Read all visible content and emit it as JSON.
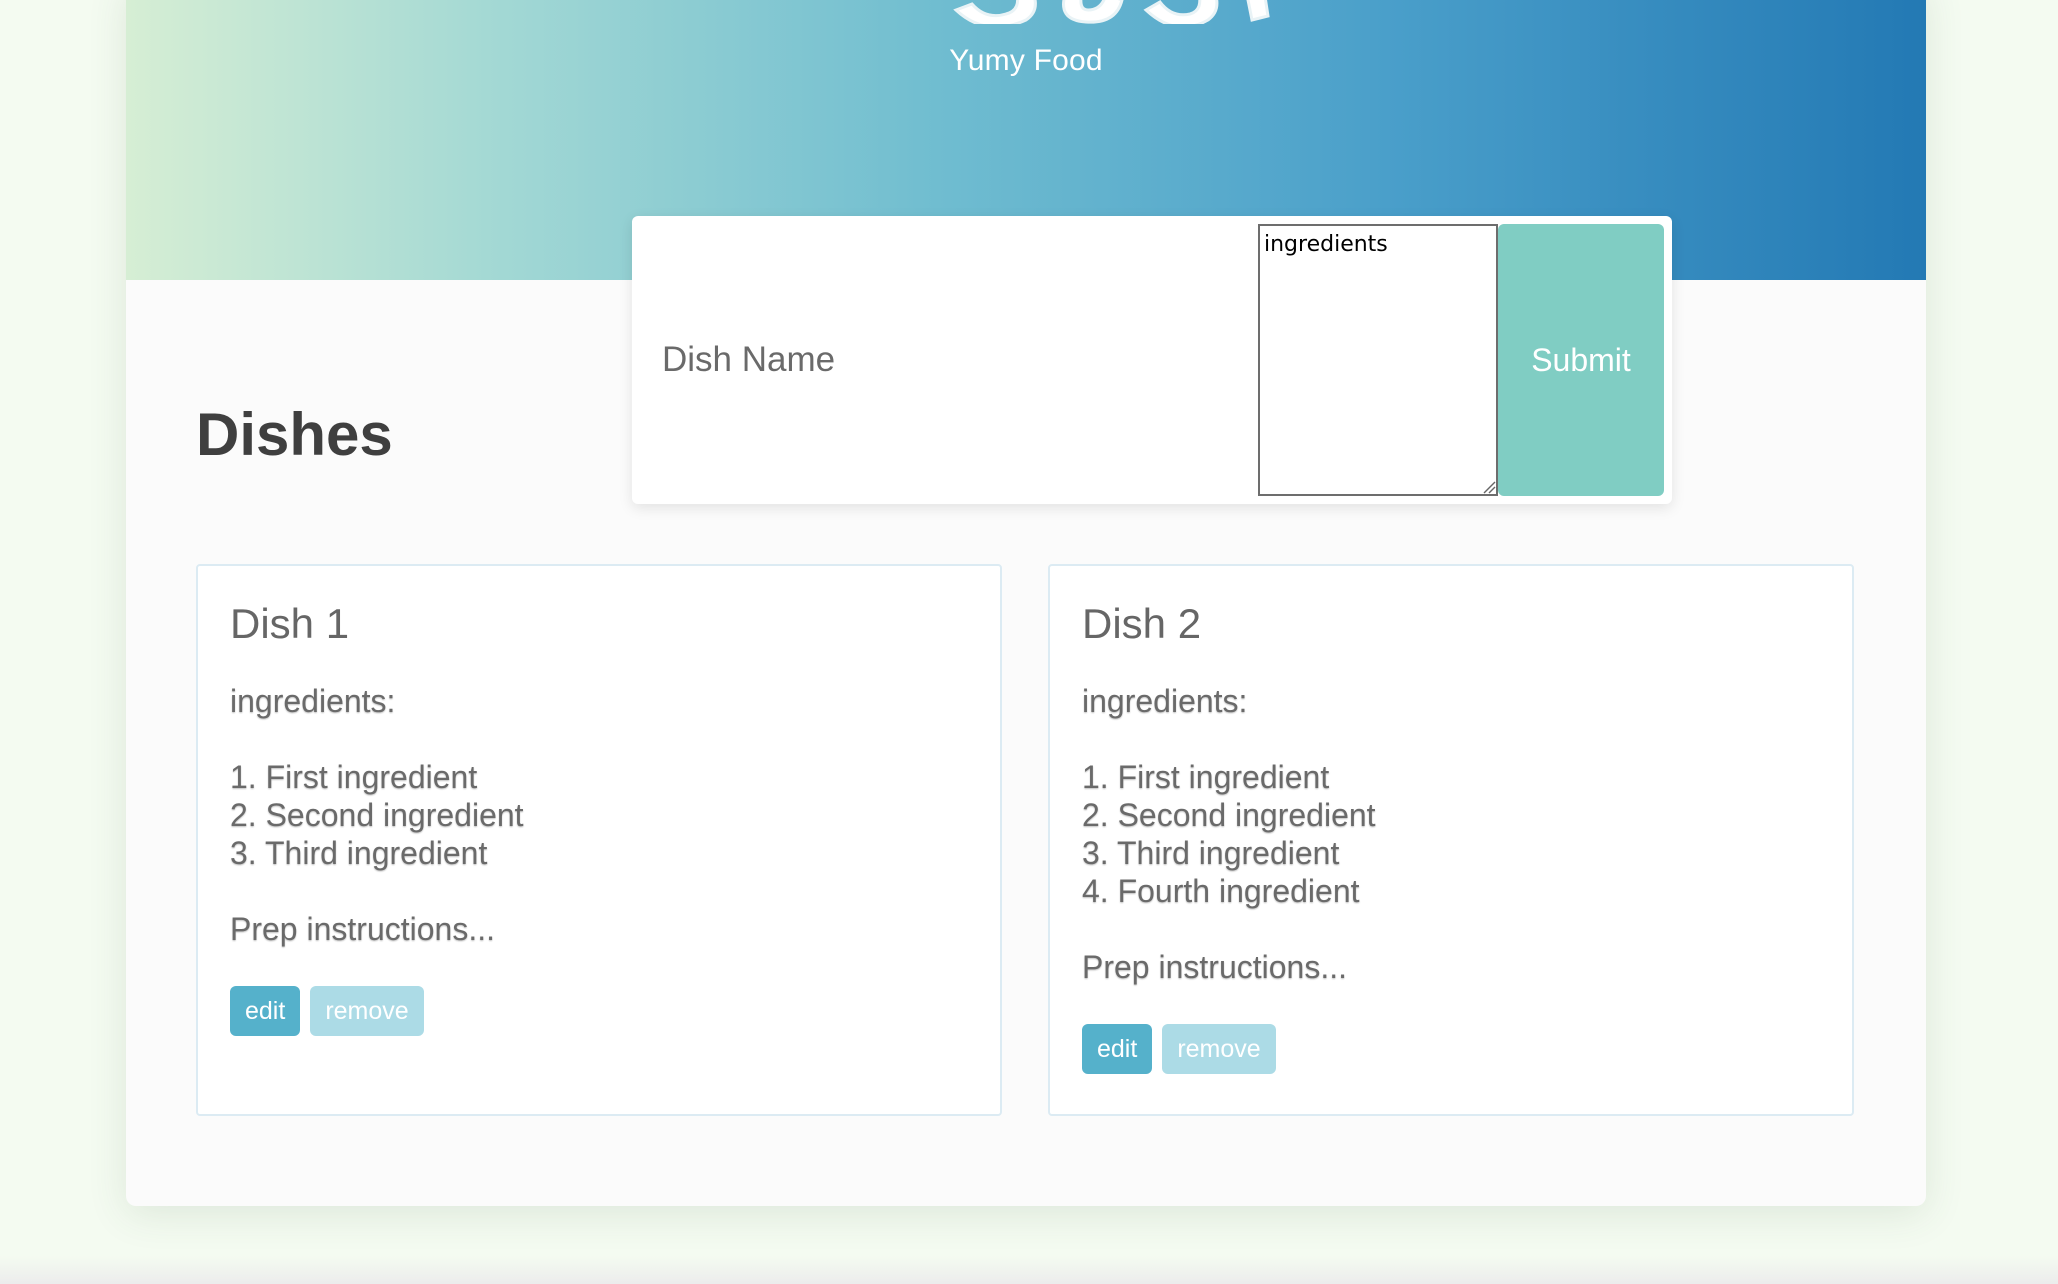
{
  "header": {
    "tagline": "Yumy Food",
    "colors": {
      "gradient_start": "#d6eed4",
      "gradient_end": "#2379b4"
    }
  },
  "form": {
    "dish_name_placeholder": "Dish Name",
    "ingredients_placeholder": "ingredients",
    "submit_label": "Submit",
    "submit_color": "#80cdc3"
  },
  "main": {
    "section_title": "Dishes"
  },
  "dishes": [
    {
      "title": "Dish 1",
      "ingredients_label": "ingredients:",
      "ingredients": [
        "1. First ingredient",
        "2. Second ingredient",
        "3. Third ingredient"
      ],
      "prep": "Prep instructions...",
      "edit_label": "edit",
      "remove_label": "remove"
    },
    {
      "title": "Dish 2",
      "ingredients_label": "ingredients:",
      "ingredients": [
        "1. First ingredient",
        "2. Second ingredient",
        "3. Third ingredient",
        "4. Fourth ingredient"
      ],
      "prep": "Prep instructions...",
      "edit_label": "edit",
      "remove_label": "remove"
    }
  ]
}
